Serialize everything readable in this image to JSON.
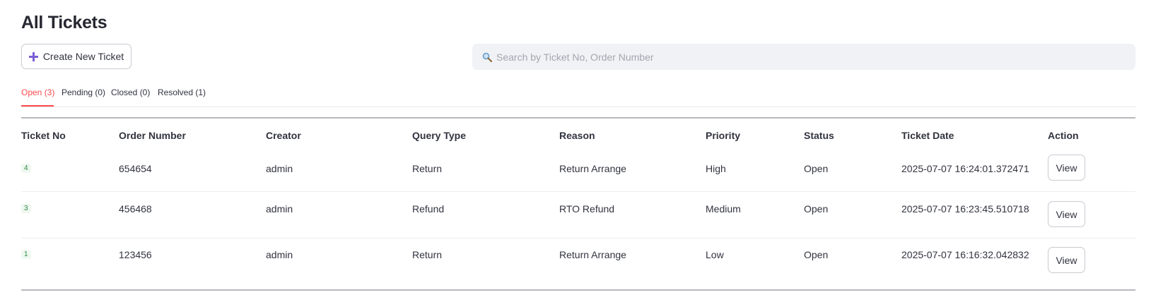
{
  "page": {
    "title": "All Tickets"
  },
  "toolbar": {
    "create_label": "Create New Ticket",
    "create_icon": "plus-icon",
    "accent_color": "#7b5fd6"
  },
  "search": {
    "placeholder": "Search by Ticket No, Order Number",
    "value": "",
    "icon": "search-icon"
  },
  "tabs": [
    {
      "label": "Open (3)",
      "active": true
    },
    {
      "label": "Pending (0)",
      "active": false
    },
    {
      "label": "Closed (0)",
      "active": false
    },
    {
      "label": "Resolved (1)",
      "active": false
    }
  ],
  "colors": {
    "active_tab": "#ff4b4b",
    "ticket_badge": "#2e8b3c"
  },
  "table": {
    "columns": [
      "Ticket No",
      "Order Number",
      "Creator",
      "Query Type",
      "Reason",
      "Priority",
      "Status",
      "Ticket Date",
      "Action"
    ],
    "rows": [
      {
        "ticket_no": "4",
        "order_number": "654654",
        "creator": "admin",
        "query_type": "Return",
        "reason": "Return Arrange",
        "priority": "High",
        "status": "Open",
        "ticket_date": "2025-07-07 16:24:01.372471",
        "action": "View"
      },
      {
        "ticket_no": "3",
        "order_number": "456468",
        "creator": "admin",
        "query_type": "Refund",
        "reason": "RTO Refund",
        "priority": "Medium",
        "status": "Open",
        "ticket_date": "2025-07-07 16:23:45.510718",
        "action": "View"
      },
      {
        "ticket_no": "1",
        "order_number": "123456",
        "creator": "admin",
        "query_type": "Return",
        "reason": "Return Arrange",
        "priority": "Low",
        "status": "Open",
        "ticket_date": "2025-07-07 16:16:32.042832",
        "action": "View"
      }
    ]
  }
}
